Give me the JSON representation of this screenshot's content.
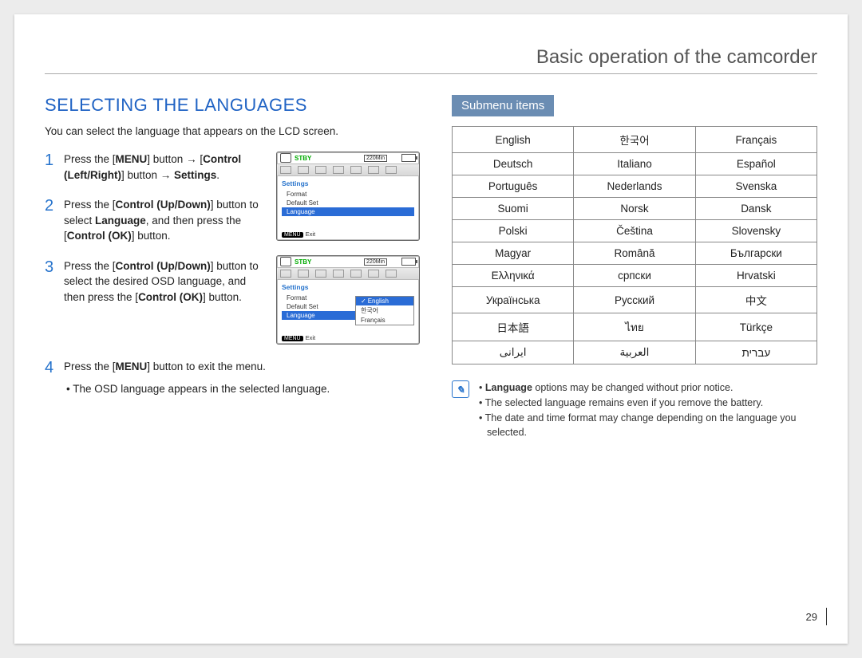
{
  "header": "Basic operation of the camcorder",
  "page_num": "29",
  "left": {
    "title": "SELECTING THE LANGUAGES",
    "intro": "You can select the language that appears on the LCD screen.",
    "step1_num": "1",
    "step1_a": "Press the [",
    "step1_menu": "MENU",
    "step1_b": "] button → [",
    "step1_ctrl_lr": "Control (Left/Right)",
    "step1_c": "] button → ",
    "step1_settings": "Settings",
    "step1_d": ".",
    "step2_num": "2",
    "step2_a": "Press the [",
    "step2_ctrl_ud": "Control (Up/Down)",
    "step2_b": "] button to select ",
    "step2_lang": "Language",
    "step2_c": ", and then press the [",
    "step2_ctrl_ok": "Control (OK)",
    "step2_d": "] button.",
    "step3_num": "3",
    "step3_a": "Press the [",
    "step3_ctrl_ud": "Control (Up/Down)",
    "step3_b": "] button to select the desired OSD language, and then press the [",
    "step3_ctrl_ok": "Control (OK)",
    "step3_c": "] button.",
    "step4_num": "4",
    "step4_a": "Press the [",
    "step4_menu": "MENU",
    "step4_b": "] button to exit the menu.",
    "step4_sub": "The OSD language appears in the selected language."
  },
  "shots": {
    "stby": "STBY",
    "min": "220Min",
    "head": "Settings",
    "format": "Format",
    "default": "Default Set",
    "language": "Language",
    "exit_tag": "MENU",
    "exit": "Exit",
    "english": "English",
    "korean": "한국어",
    "francais": "Français"
  },
  "right": {
    "submenu": "Submenu items",
    "table": [
      [
        "English",
        "한국어",
        "Français"
      ],
      [
        "Deutsch",
        "Italiano",
        "Español"
      ],
      [
        "Português",
        "Nederlands",
        "Svenska"
      ],
      [
        "Suomi",
        "Norsk",
        "Dansk"
      ],
      [
        "Polski",
        "Čeština",
        "Slovensky"
      ],
      [
        "Magyar",
        "Română",
        "Български"
      ],
      [
        "Ελληνικά",
        "српски",
        "Hrvatski"
      ],
      [
        "Українська",
        "Русский",
        "中文"
      ],
      [
        "日本語",
        "ไทย",
        "Türkçe"
      ],
      [
        "ایرانی",
        "العربية",
        "עברית"
      ]
    ],
    "note1_a": "Language",
    "note1_b": " options may be changed without prior notice.",
    "note2": "The selected language remains even if you remove the battery.",
    "note3": "The date and time format may change depending on the language you selected."
  }
}
